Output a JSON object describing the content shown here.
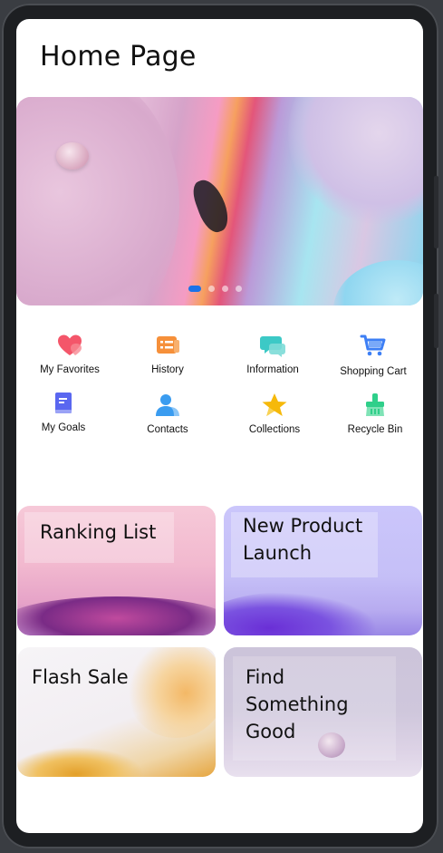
{
  "page": {
    "title": "Home Page"
  },
  "banner": {
    "slide_count": 4,
    "active_index": 0
  },
  "shortcuts": [
    {
      "label": "My Favorites",
      "icon": "heart-icon",
      "color": "#f4566a"
    },
    {
      "label": "History",
      "icon": "history-icon",
      "color": "#f6903a"
    },
    {
      "label": "Information",
      "icon": "chat-icon",
      "color": "#3cc9c6"
    },
    {
      "label": "Shopping Cart",
      "icon": "cart-icon",
      "color": "#3d7ff5"
    },
    {
      "label": "My Goals",
      "icon": "book-icon",
      "color": "#5a67f0"
    },
    {
      "label": "Contacts",
      "icon": "person-icon",
      "color": "#3a9cf0"
    },
    {
      "label": "Collections",
      "icon": "star-icon",
      "color": "#f6b90a"
    },
    {
      "label": "Recycle Bin",
      "icon": "broom-icon",
      "color": "#2fcf8a"
    }
  ],
  "cards": [
    {
      "title": "Ranking List"
    },
    {
      "title": "New Product Launch",
      "lines": [
        "New Product",
        "Launch"
      ]
    },
    {
      "title": "Flash Sale"
    },
    {
      "title": "Find Something Good",
      "lines": [
        "Find",
        "Something",
        "Good"
      ]
    }
  ]
}
